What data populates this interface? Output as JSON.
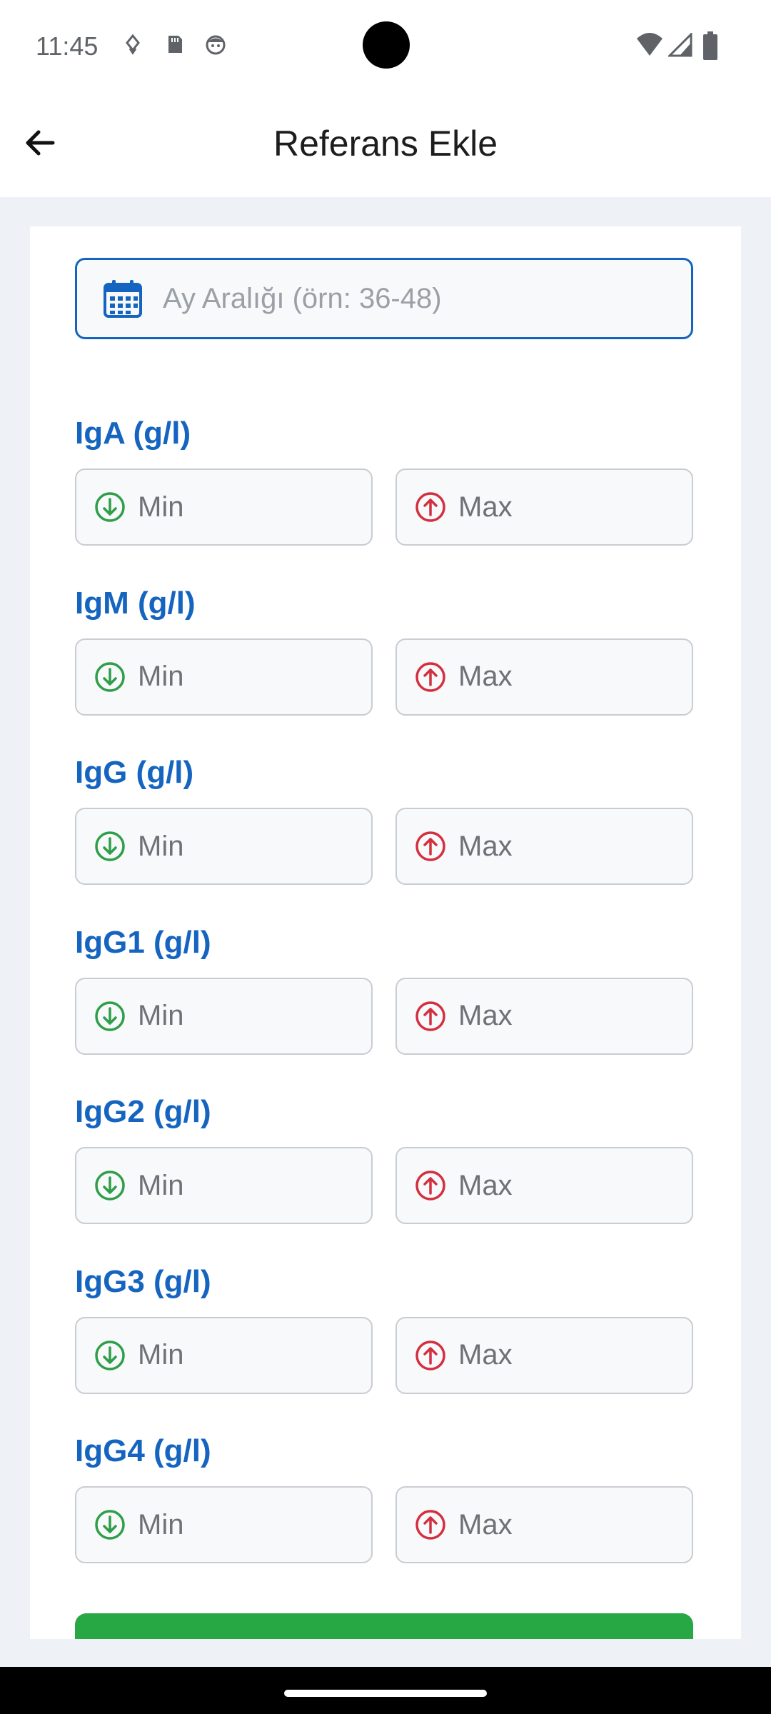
{
  "status_bar": {
    "time": "11:45"
  },
  "app_bar": {
    "title": "Referans Ekle"
  },
  "form": {
    "month_range_placeholder": "Ay Aralığı (örn: 36-48)",
    "groups": [
      {
        "label": "IgA (g/l)",
        "min_placeholder": "Min",
        "max_placeholder": "Max"
      },
      {
        "label": "IgM (g/l)",
        "min_placeholder": "Min",
        "max_placeholder": "Max"
      },
      {
        "label": "IgG (g/l)",
        "min_placeholder": "Min",
        "max_placeholder": "Max"
      },
      {
        "label": "IgG1 (g/l)",
        "min_placeholder": "Min",
        "max_placeholder": "Max"
      },
      {
        "label": "IgG2 (g/l)",
        "min_placeholder": "Min",
        "max_placeholder": "Max"
      },
      {
        "label": "IgG3 (g/l)",
        "min_placeholder": "Min",
        "max_placeholder": "Max"
      },
      {
        "label": "IgG4 (g/l)",
        "min_placeholder": "Min",
        "max_placeholder": "Max"
      }
    ]
  },
  "colors": {
    "accent": "#1565c0",
    "min_icon": "#2e9e48",
    "max_icon": "#d32f3f",
    "save_button": "#28a745"
  },
  "icons": {
    "back": "arrow-left-icon",
    "calendar": "calendar-icon",
    "min": "arrow-down-circle-icon",
    "max": "arrow-up-circle-icon"
  }
}
